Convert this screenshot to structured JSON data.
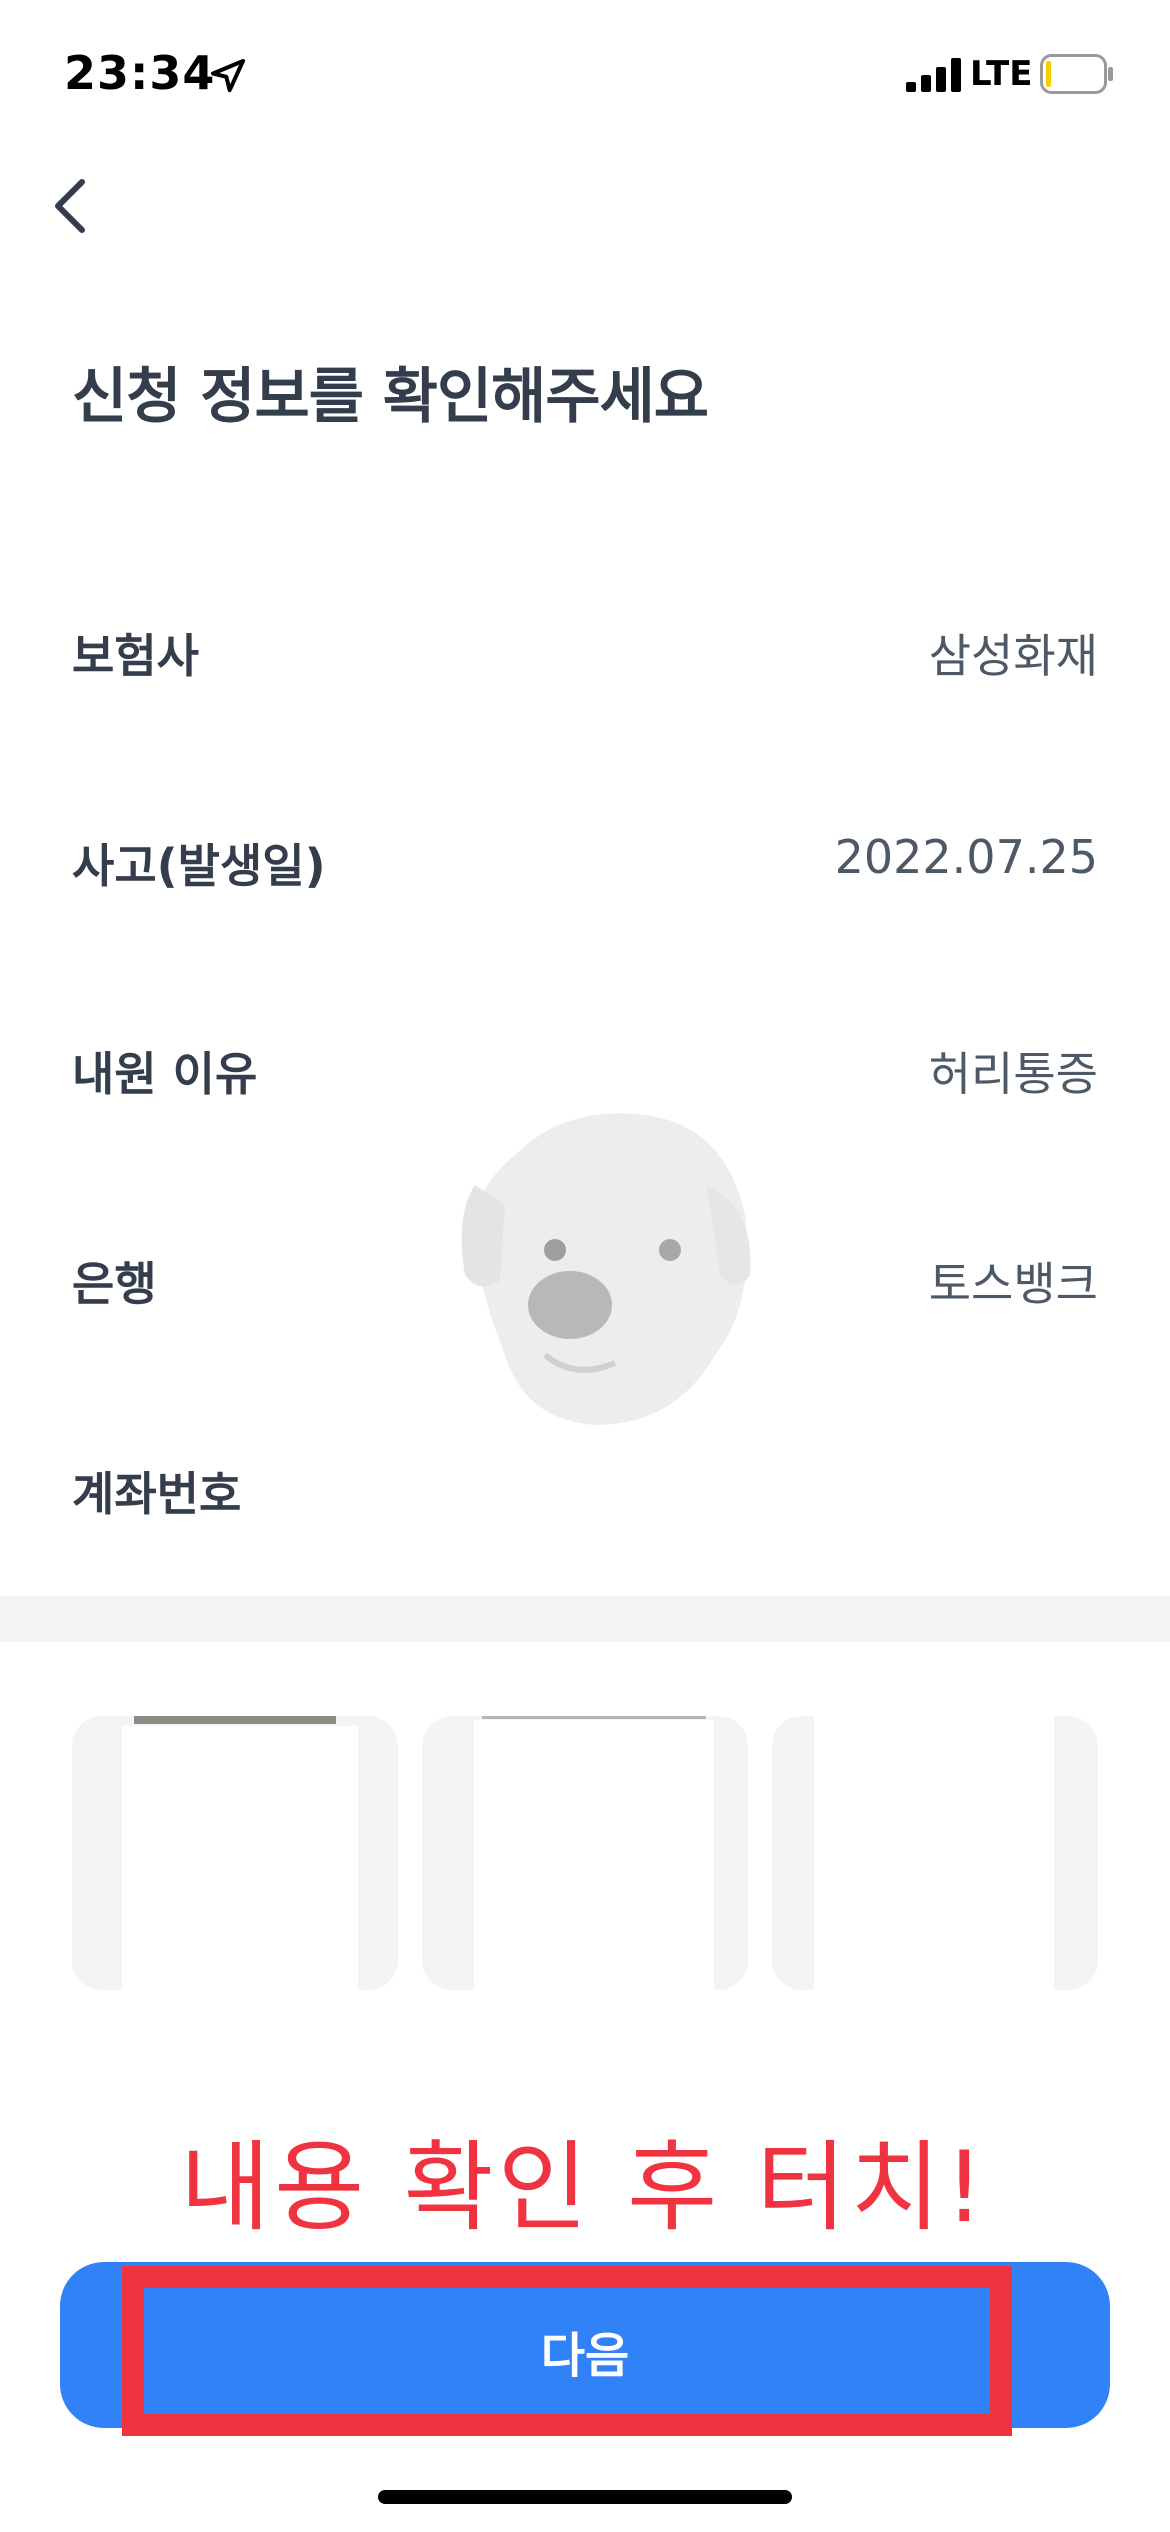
{
  "status_bar": {
    "time": "23:34",
    "network": "LTE",
    "icons": [
      "location-arrow-icon",
      "signal-icon",
      "battery-icon"
    ],
    "battery_fill_fraction": 0.05
  },
  "nav": {
    "back_icon": "chevron-left-icon"
  },
  "page": {
    "title": "신청 정보를 확인해주세요"
  },
  "info_rows": [
    {
      "label": "보험사",
      "value": "삼성화재"
    },
    {
      "label": "사고(발생일)",
      "value": "2022.07.25"
    },
    {
      "label": "내원 이유",
      "value": "허리통증"
    },
    {
      "label": "은행",
      "value": "토스뱅크"
    },
    {
      "label": "계좌번호",
      "value": ""
    }
  ],
  "documents": {
    "count_visible": 3
  },
  "annotation": {
    "text": "내용 확인 후 터치!"
  },
  "footer": {
    "next_label": "다음"
  },
  "colors": {
    "primary": "#3182f6",
    "annotation_red": "#ef3340",
    "text_dark": "#333d4b",
    "text_gray": "#4e5968",
    "divider": "#f2f4f6"
  }
}
